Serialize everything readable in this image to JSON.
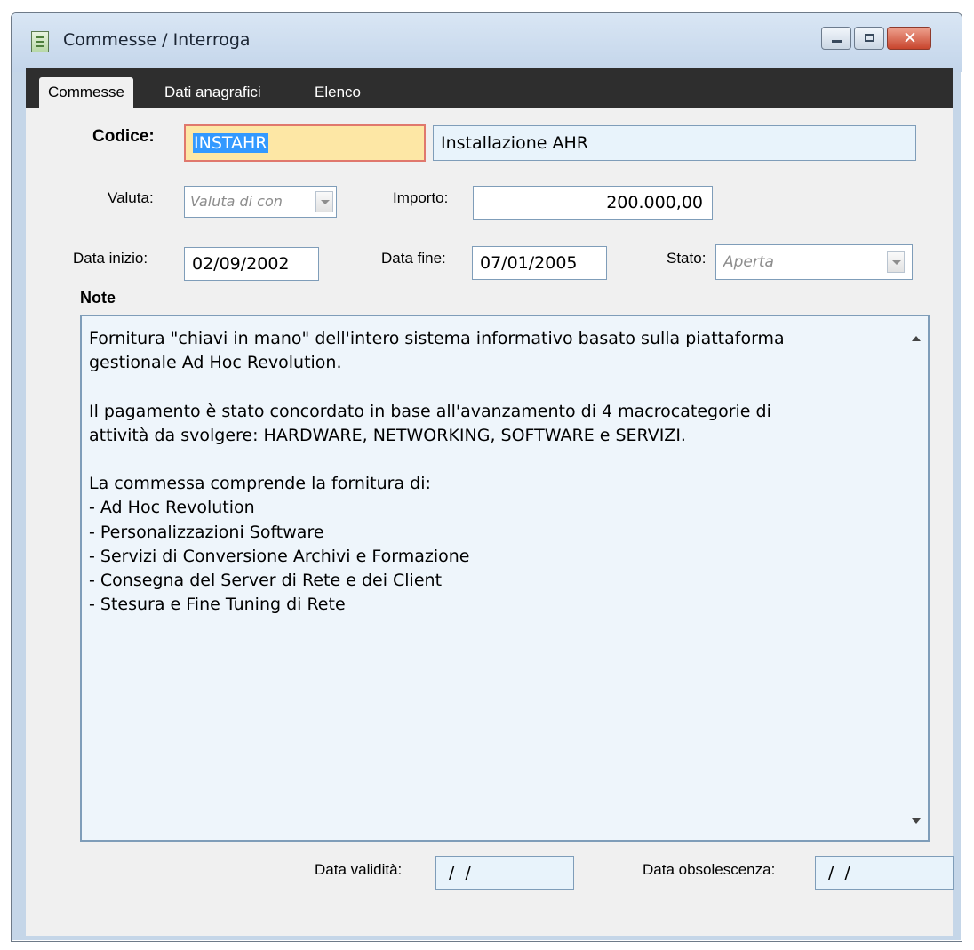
{
  "window": {
    "title": "Commesse / Interroga",
    "controls": {
      "minimize": "minimize-icon",
      "maximize": "maximize-icon",
      "close": "close-icon"
    }
  },
  "tabs": [
    {
      "label": "Commesse",
      "active": true
    },
    {
      "label": "Dati anagrafici",
      "active": false
    },
    {
      "label": "Elenco",
      "active": false
    }
  ],
  "form": {
    "codice": {
      "label": "Codice:",
      "value": "INSTAHR",
      "description": "Installazione AHR"
    },
    "valuta": {
      "label": "Valuta:",
      "value": "Valuta di con"
    },
    "importo": {
      "label": "Importo:",
      "value": "200.000,00"
    },
    "data_inizio": {
      "label": "Data inizio:",
      "value": "02/09/2002"
    },
    "data_fine": {
      "label": "Data fine:",
      "value": "07/01/2005"
    },
    "stato": {
      "label": "Stato:",
      "value": "Aperta"
    },
    "note": {
      "label": "Note",
      "text": "Fornitura \"chiavi in mano\" dell'intero sistema informativo basato sulla piattaforma\ngestionale Ad Hoc Revolution.\n\nIl pagamento è stato concordato in base all'avanzamento di 4 macrocategorie di\nattività da svolgere: HARDWARE, NETWORKING, SOFTWARE e SERVIZI.\n\nLa commessa comprende la fornitura di:\n- Ad Hoc Revolution\n- Personalizzazioni Software\n- Servizi di Conversione Archivi e Formazione\n- Consegna del Server di Rete e dei Client\n- Stesura e Fine Tuning di Rete"
    },
    "data_validita": {
      "label": "Data validità:",
      "value": " /  /"
    },
    "data_obsolescenza": {
      "label": "Data obsolescenza:",
      "value": " /  /"
    }
  },
  "colors": {
    "titlebar": "#c8d8ea",
    "tabbar": "#2e2e2e",
    "panel": "#f0f0f0",
    "field_border": "#7f9db9",
    "selection": "#3399ff",
    "codice_bg": "#fde7a5"
  }
}
